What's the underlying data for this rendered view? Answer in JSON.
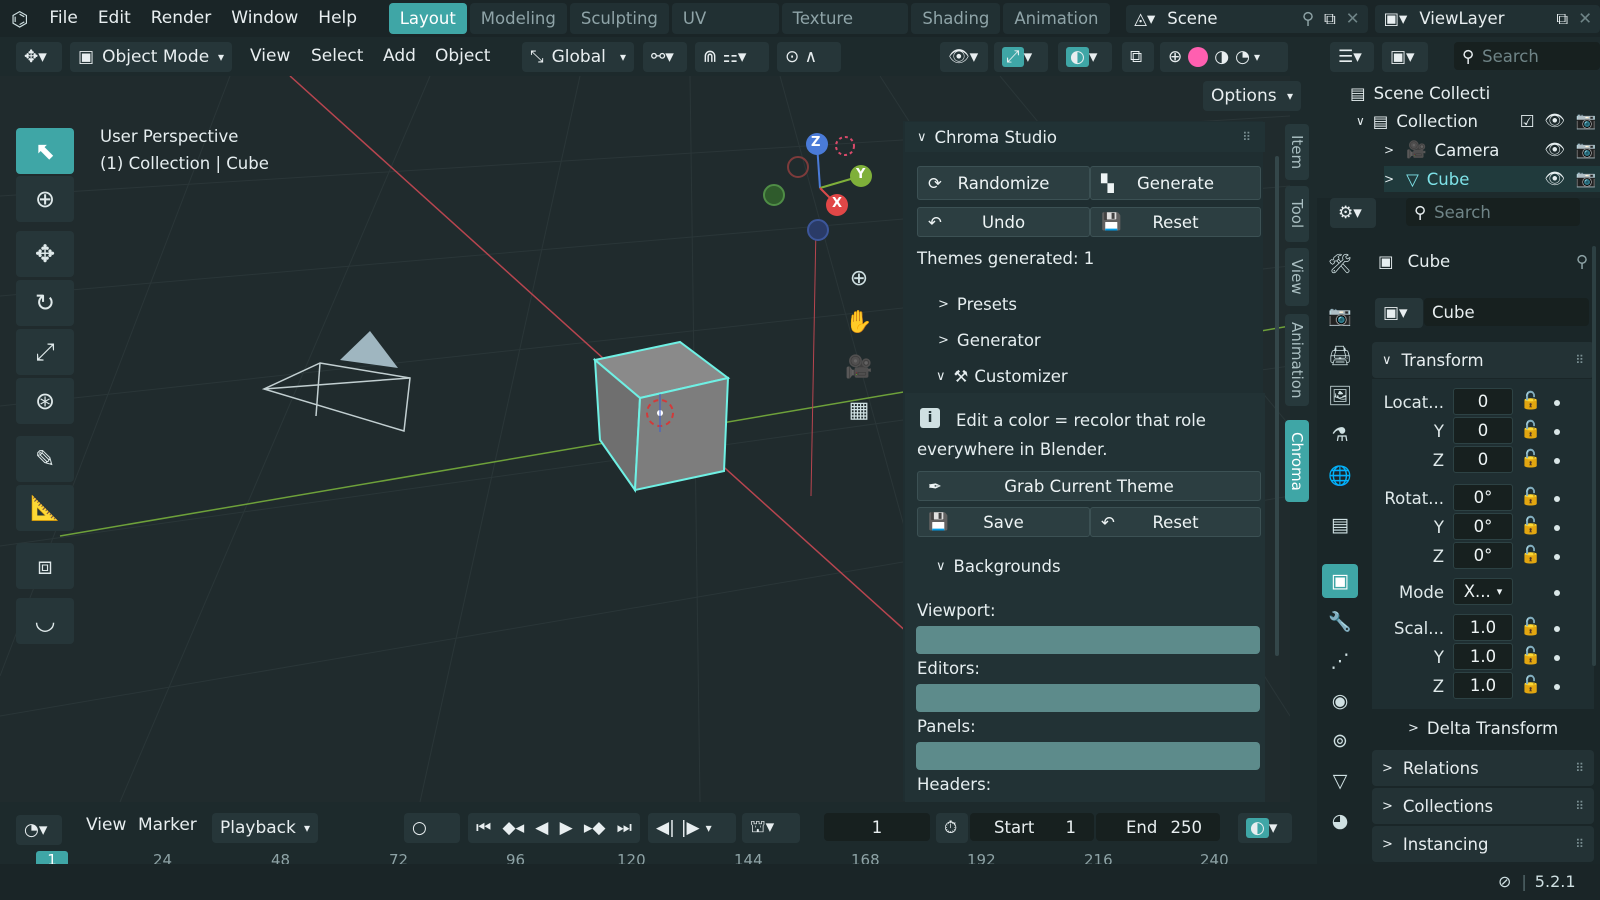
{
  "menu": [
    "File",
    "Edit",
    "Render",
    "Window",
    "Help"
  ],
  "workspaces": [
    "Layout",
    "Modeling",
    "Sculpting",
    "UV Editing",
    "Texture Paint",
    "Shading",
    "Animation"
  ],
  "scene": {
    "label": "Scene"
  },
  "view_layer": {
    "label": "ViewLayer"
  },
  "header": {
    "mode": "Object Mode",
    "menus": [
      "View",
      "Select",
      "Add",
      "Object"
    ],
    "orientation": "Global",
    "options": "Options"
  },
  "viewport": {
    "perspective": "User Perspective",
    "collection_info": "(1) Collection | Cube",
    "gizmo_axes": [
      "Z",
      "Y",
      "X"
    ]
  },
  "side_tabs": [
    "Item",
    "Tool",
    "View",
    "Animation",
    "Chroma"
  ],
  "chroma": {
    "title": "Chroma Studio",
    "randomize": "Randomize",
    "generate": "Generate",
    "undo": "Undo",
    "reset": "Reset",
    "themes_generated": "Themes generated: 1",
    "presets": "Presets",
    "generator": "Generator",
    "customizer": "Customizer",
    "info_line1": "Edit a color = recolor that role",
    "info_line2": "everywhere in Blender.",
    "grab_theme": "Grab Current Theme",
    "save": "Save",
    "reset2": "Reset",
    "backgrounds": "Backgrounds",
    "viewport_label": "Viewport:",
    "editors_label": "Editors:",
    "panels_label": "Panels:",
    "headers_label": "Headers:",
    "swatch_color": "#5d8b8b"
  },
  "outliner": {
    "search_placeholder": "Search",
    "scene_collection": "Scene Collecti",
    "collection": "Collection",
    "camera": "Camera",
    "cube": "Cube"
  },
  "properties": {
    "search_placeholder": "Search",
    "object_name": "Cube",
    "data_name": "Cube",
    "transform": "Transform",
    "location_label": "Locat...",
    "rotation_label": "Rotat...",
    "scale_label": "Scal...",
    "mode_label": "Mode",
    "mode_value": "X...",
    "y": "Y",
    "z": "Z",
    "loc": [
      "0",
      "0",
      "0"
    ],
    "rot": [
      "0°",
      "0°",
      "0°"
    ],
    "scale": [
      "1.0",
      "1.0",
      "1.0"
    ],
    "delta_transform": "Delta Transform",
    "relations": "Relations",
    "collections": "Collections",
    "instancing": "Instancing"
  },
  "timeline": {
    "menus": [
      "View",
      "Marker"
    ],
    "playback": "Playback",
    "current_frame": "1",
    "start_label": "Start",
    "start_value": "1",
    "end_label": "End",
    "end_value": "250",
    "ruler": [
      "1",
      "24",
      "48",
      "72",
      "96",
      "120",
      "144",
      "168",
      "192",
      "216",
      "240"
    ]
  },
  "status": {
    "version": "5.2.1"
  },
  "colors": {
    "accent": "#3fa6a6",
    "background": "#1d2a2c",
    "panel": "#1f2e31"
  }
}
